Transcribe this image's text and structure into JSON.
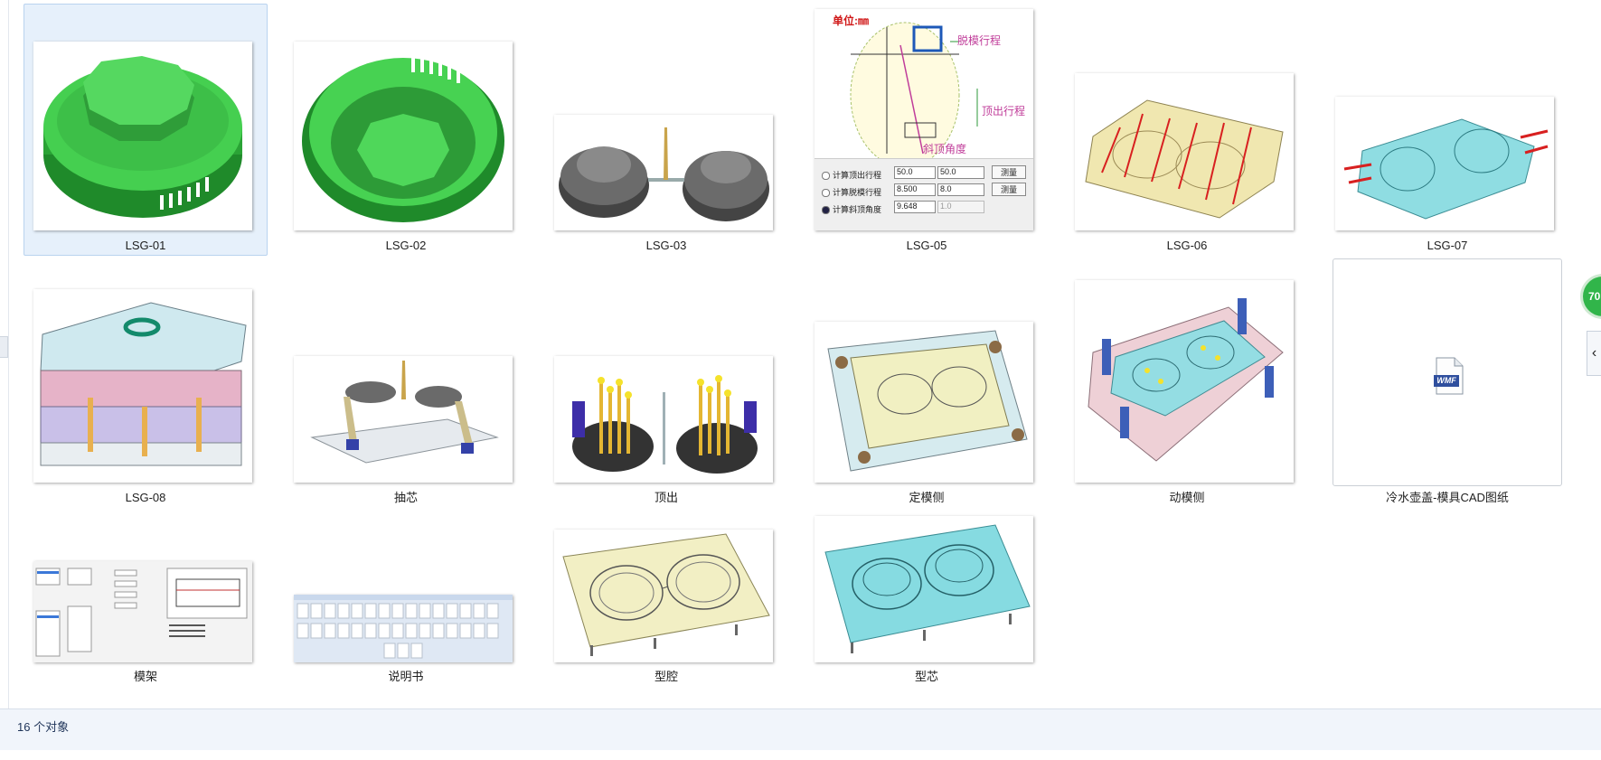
{
  "window": {
    "status_text": "16 个对象"
  },
  "badge": {
    "value": "70"
  },
  "files": [
    {
      "name": "LSG-01",
      "icon": "green-cap-render"
    },
    {
      "name": "LSG-02",
      "icon": "green-cup-render"
    },
    {
      "name": "LSG-03",
      "icon": "gray-parts-render"
    },
    {
      "name": "LSG-05",
      "icon": "calculation-diagram"
    },
    {
      "name": "LSG-06",
      "icon": "yellow-mold-render"
    },
    {
      "name": "LSG-07",
      "icon": "cyan-mold-render"
    },
    {
      "name": "LSG-08",
      "icon": "mold-assembly-render"
    },
    {
      "name": "抽芯",
      "icon": "core-pull-render"
    },
    {
      "name": "顶出",
      "icon": "ejector-render"
    },
    {
      "name": "定模侧",
      "icon": "fixed-side-render"
    },
    {
      "name": "动模侧",
      "icon": "moving-side-render"
    },
    {
      "name": "冷水壶盖-模具CAD图纸",
      "icon": "wmf-file-icon",
      "icon_text": "WMF"
    },
    {
      "name": "模架",
      "icon": "mold-base-dialog"
    },
    {
      "name": "说明书",
      "icon": "manual-pages"
    },
    {
      "name": "型腔",
      "icon": "cavity-render"
    },
    {
      "name": "型芯",
      "icon": "core-render"
    }
  ],
  "diagram": {
    "unit_label": "单位:㎜",
    "label_demold": "脱模行程",
    "label_eject": "顶出行程",
    "label_angle": "斜顶角度",
    "rows": [
      {
        "label": "计算顶出行程",
        "value": "50.0",
        "select": "50.0",
        "button": "测量"
      },
      {
        "label": "计算脱模行程",
        "value": "8.500",
        "select": "8.0",
        "button": "测量"
      },
      {
        "label": "计算斜顶角度",
        "value": "9.648",
        "select": "1.0",
        "button": ""
      }
    ]
  },
  "colors": {
    "selection": "#e6f0fb",
    "status_bar": "#f1f5fb",
    "part_green": "#3fc94a",
    "mold_yellow": "#efe6ad",
    "mold_cyan": "#7fd9df",
    "badge_green": "#31b54a"
  }
}
